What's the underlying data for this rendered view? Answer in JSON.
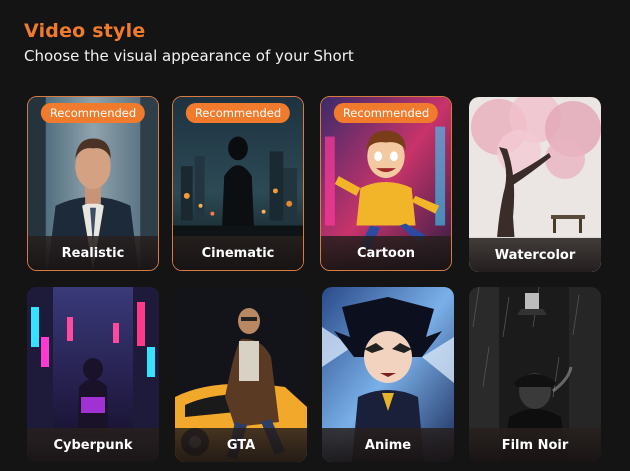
{
  "header": {
    "title": "Video style",
    "subtitle": "Choose the visual appearance of your Short"
  },
  "badge_label": "Recommended",
  "accent_color": "#f07b2c",
  "styles": [
    {
      "label": "Realistic",
      "recommended": true
    },
    {
      "label": "Cinematic",
      "recommended": true
    },
    {
      "label": "Cartoon",
      "recommended": true
    },
    {
      "label": "Watercolor",
      "recommended": false
    },
    {
      "label": "Cyberpunk",
      "recommended": false
    },
    {
      "label": "GTA",
      "recommended": false
    },
    {
      "label": "Anime",
      "recommended": false
    },
    {
      "label": "Film Noir",
      "recommended": false
    }
  ]
}
